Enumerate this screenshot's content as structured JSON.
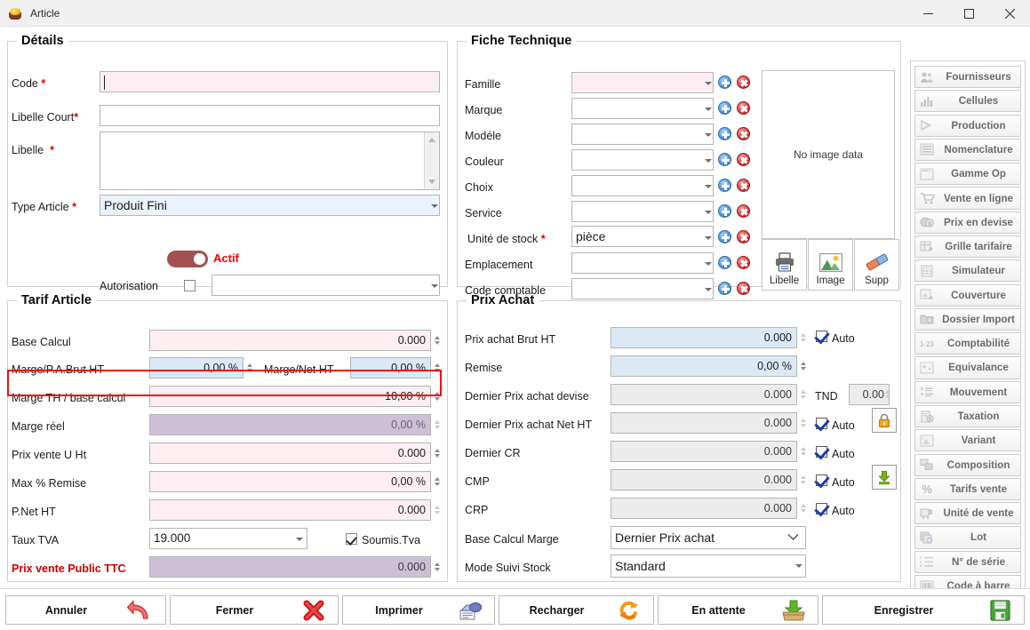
{
  "window": {
    "title": "Article",
    "icon": "article-pot-icon",
    "controls": {
      "minimize": "—",
      "maximize": "☐",
      "close": "✕"
    }
  },
  "details": {
    "legend": "Détails",
    "fields": {
      "code": {
        "label": "Code",
        "required": "*",
        "value": ""
      },
      "libelle_court": {
        "label": "Libelle Court",
        "required": "*",
        "value": ""
      },
      "libelle": {
        "label": "Libelle",
        "required": "*",
        "value": ""
      },
      "type_article": {
        "label": "Type Article",
        "required": "*",
        "value": "Produit Fini"
      },
      "actif": {
        "label": "Actif",
        "state": "on"
      },
      "autorisation": {
        "label": "Autorisation",
        "checked": false,
        "value": ""
      }
    }
  },
  "fiche_technique": {
    "legend": "Fiche Technique",
    "rows": [
      {
        "label": "Famille",
        "required": "",
        "value": "",
        "highlight": "pink"
      },
      {
        "label": "Marque",
        "required": "",
        "value": "",
        "highlight": ""
      },
      {
        "label": "Modéle",
        "required": "",
        "value": "",
        "highlight": ""
      },
      {
        "label": "Couleur",
        "required": "",
        "value": "",
        "highlight": ""
      },
      {
        "label": "Choix",
        "required": "",
        "value": "",
        "highlight": ""
      },
      {
        "label": "Service",
        "required": "",
        "value": "",
        "highlight": ""
      },
      {
        "label": "Unité de stock",
        "required": "*",
        "value": "pièce",
        "highlight": ""
      },
      {
        "label": "Emplacement",
        "required": "",
        "value": "",
        "highlight": ""
      },
      {
        "label": "Code comptable",
        "required": "",
        "value": "",
        "highlight": ""
      }
    ],
    "image_panel": {
      "placeholder": "No image data"
    },
    "image_buttons": [
      {
        "label": "Libelle",
        "icon": "printer-icon"
      },
      {
        "label": "Image",
        "icon": "picture-icon"
      },
      {
        "label": "Supp",
        "icon": "eraser-icon"
      }
    ]
  },
  "tarif_article": {
    "legend": "Tarif Article",
    "rows": {
      "base_calcul": {
        "label": "Base Calcul",
        "value": "0.000"
      },
      "marge_pa_brut": {
        "label": "Marge/P.A.Brut HT",
        "value": "0,00 %"
      },
      "marge_net": {
        "label": "Marge/Net HT",
        "value": "0,00 %"
      },
      "marge_th": {
        "label": "Marge TH / base calcul",
        "value": "10,00 %",
        "highlighted": true
      },
      "marge_reel": {
        "label": "Marge réel",
        "value": "0,00 %"
      },
      "prix_vente_u_ht": {
        "label": "Prix vente U Ht",
        "value": "0.000"
      },
      "max_remise": {
        "label": "Max % Remise",
        "value": "0,00 %"
      },
      "p_net_ht": {
        "label": "P.Net HT",
        "value": "0.000"
      },
      "taux_tva": {
        "label": "Taux TVA",
        "value": "19.000"
      },
      "soumis_tva": {
        "label": "Soumis.Tva",
        "checked": true
      },
      "prix_vente_public_ttc": {
        "label": "Prix vente Public TTC",
        "value": "0.000"
      }
    }
  },
  "prix_achat": {
    "legend": "Prix Achat",
    "rows": [
      {
        "label": "Prix achat Brut HT",
        "value": "0.000",
        "style": "blue",
        "auto": "Auto",
        "has_auto": true
      },
      {
        "label": "Remise",
        "value": "0,00 %",
        "style": "blue",
        "auto": "",
        "has_auto": false
      },
      {
        "label": "Dernier Prix achat devise",
        "value": "0.000",
        "style": "grey",
        "auto": "",
        "has_auto": false
      },
      {
        "label": "Dernier Prix achat Net HT",
        "value": "0.000",
        "style": "grey",
        "auto": "Auto",
        "has_auto": true
      },
      {
        "label": "Dernier CR",
        "value": "0.000",
        "style": "grey",
        "auto": "Auto",
        "has_auto": true
      },
      {
        "label": "CMP",
        "value": "0.000",
        "style": "grey",
        "auto": "Auto",
        "has_auto": true
      },
      {
        "label": "CRP",
        "value": "0.000",
        "style": "grey",
        "auto": "Auto",
        "has_auto": true
      }
    ],
    "currency": {
      "code": "TND",
      "value": "0.00"
    },
    "base_calcul_marge": {
      "label": "Base Calcul Marge",
      "value": "Dernier Prix achat"
    },
    "mode_suivi_stock": {
      "label": "Mode Suivi Stock",
      "value": "Standard"
    },
    "side_buttons": [
      {
        "name": "lock-button",
        "icon": "lock-icon"
      },
      {
        "name": "download-button",
        "icon": "download-icon"
      }
    ]
  },
  "sidebar": {
    "items": [
      {
        "label": "Fournisseurs",
        "icon": "users-icon"
      },
      {
        "label": "Cellules",
        "icon": "bar-chart-icon"
      },
      {
        "label": "Production",
        "icon": "gear-flow-icon"
      },
      {
        "label": "Nomenclature",
        "icon": "list-lines-icon"
      },
      {
        "label": "Gamme Op",
        "icon": "window-icon"
      },
      {
        "label": "Vente en ligne",
        "icon": "cart-icon"
      },
      {
        "label": "Prix en devise",
        "icon": "coins-icon"
      },
      {
        "label": "Grille tarifaire",
        "icon": "table-plus-icon"
      },
      {
        "label": "Simulateur",
        "icon": "calculator-icon"
      },
      {
        "label": "Couverture",
        "icon": "frame-plus-icon"
      },
      {
        "label": "Dossier Import",
        "icon": "folder-icon"
      },
      {
        "label": "Comptabilité",
        "icon": "numbers-icon"
      },
      {
        "label": "Equivalance",
        "icon": "sparkle-icon"
      },
      {
        "label": "Mouvement",
        "icon": "listview-icon"
      },
      {
        "label": "Taxation",
        "icon": "doc-money-icon"
      },
      {
        "label": "Variant",
        "icon": "image-star-icon"
      },
      {
        "label": "Composition",
        "icon": "squares-icon"
      },
      {
        "label": "Tarifs vente",
        "icon": "percent-icon"
      },
      {
        "label": "Unité de vente",
        "icon": "unit-icon"
      },
      {
        "label": "Lot",
        "icon": "batch-icon"
      },
      {
        "label": "N° de série",
        "icon": "ordered-list-icon"
      },
      {
        "label": "Code à barre",
        "icon": "barcode-icon"
      }
    ]
  },
  "bottom_bar": {
    "buttons": [
      {
        "label": "Annuler",
        "icon": "undo-arrow-icon"
      },
      {
        "label": "Fermer",
        "icon": "red-x-icon"
      },
      {
        "label": "Imprimer",
        "icon": "printer-icon"
      },
      {
        "label": "Recharger",
        "icon": "refresh-icon"
      },
      {
        "label": "En attente",
        "icon": "inbox-down-icon"
      },
      {
        "label": "Enregistrer",
        "icon": "floppy-save-icon"
      }
    ]
  },
  "colors": {
    "required_pink": "#fdeef2",
    "editable_blue": "#dce9f5",
    "readonly_mauve": "#cdbfd6",
    "readonly_grey": "#ececec",
    "accent_red": "#ff0000",
    "highlight_box": "#ee1111",
    "toggle_on": "#a35050"
  }
}
